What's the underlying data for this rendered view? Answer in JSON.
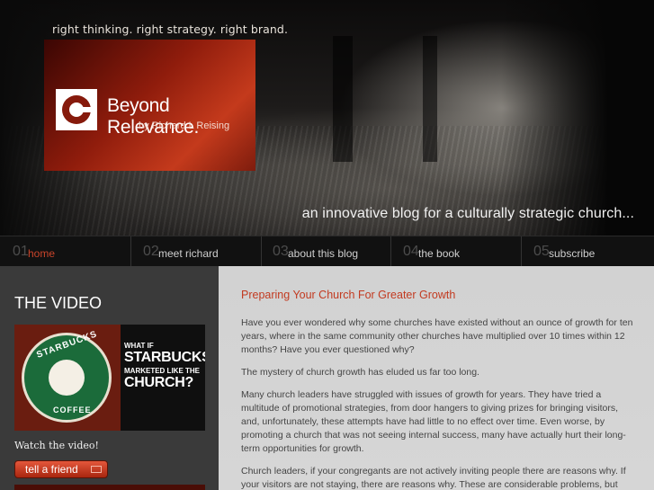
{
  "header": {
    "tagline": "right thinking.  right strategy.  right brand.",
    "logo_title": "Beyond Relevance.",
    "logo_subtitle": "by Richard L Reising",
    "slogan": "an innovative blog for a culturally strategic church..."
  },
  "nav": {
    "items": [
      {
        "num": "01",
        "label": "home",
        "active": true
      },
      {
        "num": "02",
        "label": "meet richard",
        "active": false
      },
      {
        "num": "03",
        "label": "about this blog",
        "active": false
      },
      {
        "num": "04",
        "label": "the book",
        "active": false
      },
      {
        "num": "05",
        "label": "subscribe",
        "active": false
      }
    ]
  },
  "sidebar": {
    "heading": "THE VIDEO",
    "thumbnail": {
      "logo_text_top": "STARBUCKS",
      "logo_text_bottom": "COFFEE",
      "line1": "WHAT IF",
      "line2": "STARBUCKS",
      "line3": "MARKETED LIKE THE",
      "line4": "CHURCH?"
    },
    "watch_label": "Watch the video!",
    "tell_friend_label": "tell a friend"
  },
  "post": {
    "title": "Preparing Your Church For Greater Growth",
    "paragraphs": [
      "Have you ever wondered why some churches have existed without an ounce of growth for ten years, where in the same community other churches have multiplied over 10 times within 12 months? Have you ever questioned why?",
      "The mystery of church growth has eluded us far too long.",
      "Many church leaders have struggled with issues of growth for years. They have tried a multitude of promotional strategies, from door hangers to giving prizes for bringing visitors, and, unfortunately, these attempts have had little to no effect over time. Even worse, by promoting a church that was not seeing internal success, many have actually hurt their long-term opportunities for growth.",
      "Church leaders, if your congregants are not actively inviting people there are reasons why. If your visitors are not staying, there are reasons why. These are considerable problems, but have"
    ]
  },
  "colors": {
    "accent": "#c23a20",
    "nav_bg": "#111111",
    "sidebar_bg": "#3a3a3a",
    "content_bg": "#d4d4d4"
  }
}
